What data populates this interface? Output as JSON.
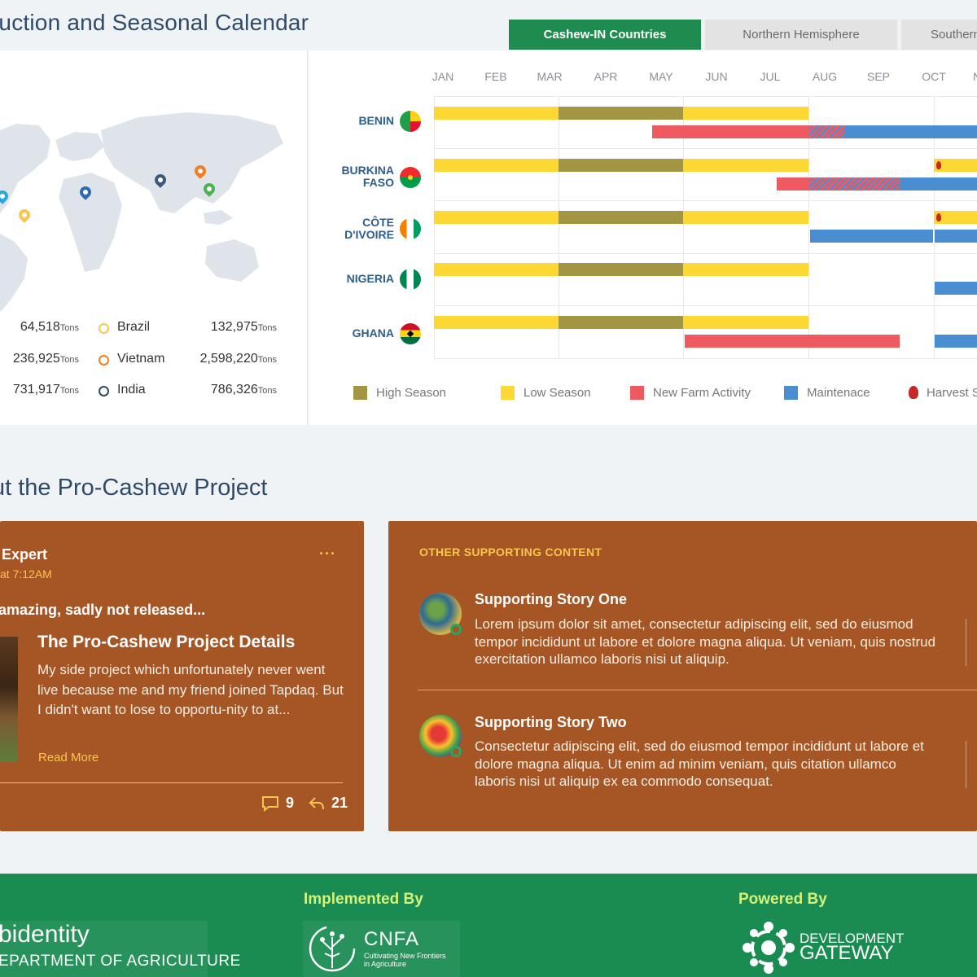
{
  "header": {
    "title": "luction and Seasonal Calendar",
    "tabs": [
      {
        "label": "Cashew-IN Countries",
        "active": true
      },
      {
        "label": "Northern Hemisphere",
        "active": false
      },
      {
        "label": "Southern",
        "active": false
      }
    ]
  },
  "stats": [
    {
      "value_left": "64,518",
      "country": "Brazil",
      "value_right": "132,975",
      "ring_color": "#f9c74f"
    },
    {
      "value_left": "236,925",
      "country": "Vietnam",
      "value_right": "2,598,220",
      "ring_color": "#f57c20"
    },
    {
      "value_left": "731,917",
      "country": "India",
      "value_right": "786,326",
      "ring_color": "#2e4a68"
    }
  ],
  "unit": "Tons",
  "calendar": {
    "months": [
      "JAN",
      "FEB",
      "MAR",
      "APR",
      "MAY",
      "JUN",
      "JUL",
      "AUG",
      "SEP",
      "OCT",
      "N"
    ],
    "countries": [
      {
        "name_line1": "BENIN",
        "name_line2": ""
      },
      {
        "name_line1": "BURKINA",
        "name_line2": "FASO"
      },
      {
        "name_line1": "CÔTE",
        "name_line2": "D'IVOIRE"
      },
      {
        "name_line1": "NIGERIA",
        "name_line2": ""
      },
      {
        "name_line1": "GHANA",
        "name_line2": ""
      }
    ],
    "legend": [
      {
        "label": "High Season",
        "color": "#a29642"
      },
      {
        "label": "Low Season",
        "color": "#fdd835"
      },
      {
        "label": "New Farm Activity",
        "color": "#ee5a5f"
      },
      {
        "label": "Maintenace",
        "color": "#4a8ed1"
      },
      {
        "label": "Harvest S",
        "color": "#c62828"
      }
    ]
  },
  "about": {
    "title": "ut the Pro-Cashew Project",
    "post": {
      "author": "Expert",
      "time": "at 7:12AM",
      "menu": "···",
      "headline": "amazing, sadly not released...",
      "detail_title": "The Pro-Cashew Project Details",
      "detail_body": "My side project which unfortunately never went live because me and my friend joined Tapdaq. But I didn't want to lose to opportu-nity to at...",
      "read_more": "Read More",
      "comments": "9",
      "shares": "21"
    },
    "supporting": {
      "heading": "OTHER SUPPORTING CONTENT",
      "stories": [
        {
          "title": "Supporting Story One",
          "body": "Lorem ipsum dolor sit amet, consectetur adipiscing elit, sed do eiusmod tempor incididunt ut labore et dolore magna aliqua. Ut veniam, quis nostrud exercitation ullamco laboris nisi ut aliquip."
        },
        {
          "title": "Supporting Story Two",
          "body": "Consectetur adipiscing elit, sed do eiusmod tempor incididunt ut labore et dolore magna aliqua. Ut enim ad minim veniam, quis citation ullamco laboris nisi ut aliquip ex ea commodo consequat."
        }
      ]
    }
  },
  "footer": {
    "partner_text_1": "bidentity",
    "partner_text_2": "EPARTMENT OF AGRICULTURE",
    "implemented_by": "Implemented By",
    "cnfa_name": "CNFA",
    "cnfa_tagline_1": "Cultivating New Frontiers",
    "cnfa_tagline_2": "in Agriculture",
    "powered_by": "Powered By",
    "dg_line1": "DEVELOPMENT",
    "dg_line2": "GATEWAY"
  },
  "colors": {
    "accent_green": "#1e8c4e",
    "card_brown": "#a65524",
    "gold": "#f9c74f"
  }
}
